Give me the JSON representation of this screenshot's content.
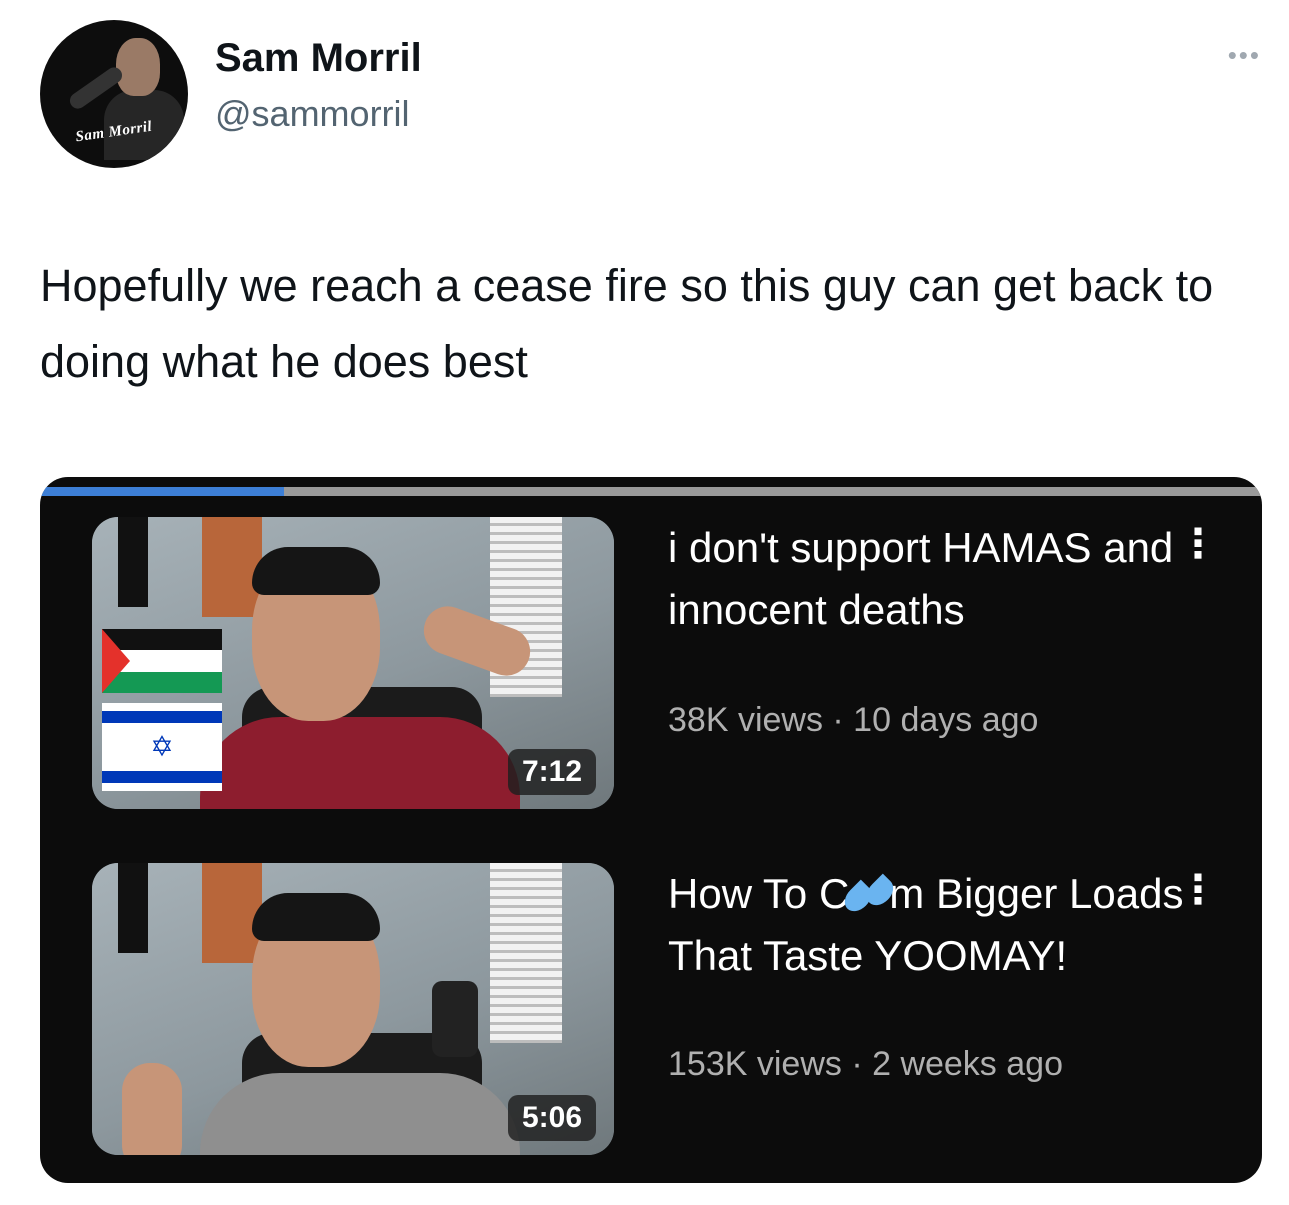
{
  "tweet": {
    "author_name": "Sam Morril",
    "author_handle": "@sammorril",
    "more_icon": "ellipsis-icon",
    "avatar_logo": "Sam Morril",
    "text": "Hopefully we reach a cease fire so this guy can get back to doing what he does best"
  },
  "player": {
    "progress_fraction": 0.2,
    "accent_color": "#3d7fd6"
  },
  "videos": [
    {
      "title": "i don't support HAMAS and innocent deaths",
      "meta": "38K views · 10 days ago",
      "duration": "7:12",
      "more_icon": "vertical-ellipsis-icon"
    },
    {
      "title_before": "How To C",
      "title_icon": "sweat-droplets-icon",
      "title_after": "m Bigger Loads That Taste YOOMAY!",
      "meta": "153K views · 2 weeks ago",
      "duration": "5:06",
      "more_icon": "vertical-ellipsis-icon"
    }
  ]
}
